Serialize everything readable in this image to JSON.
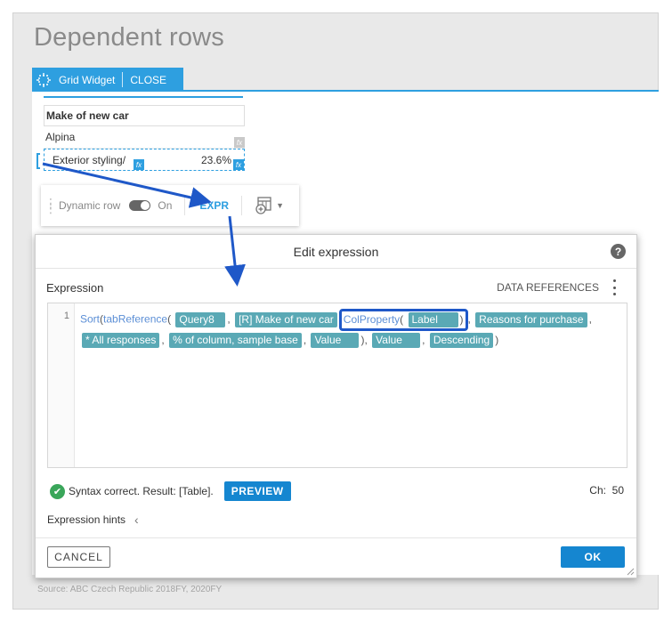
{
  "page": {
    "title": "Dependent rows",
    "source": "Source: ABC Czech Republic 2018FY, 2020FY"
  },
  "widget_toolbar": {
    "label": "Grid Widget",
    "close": "CLOSE"
  },
  "grid": {
    "header": "Make of new car",
    "rows": [
      {
        "label": "Alpina",
        "value": ""
      },
      {
        "label": "Exterior styling/",
        "value": "23.6%"
      }
    ],
    "fx_label": "fx"
  },
  "row_toolbar": {
    "dynamic_row_label": "Dynamic row",
    "toggle_state": "On",
    "expr_button": "EXPR"
  },
  "dialog": {
    "title": "Edit expression",
    "help": "?",
    "expression_label": "Expression",
    "data_references": "DATA REFERENCES",
    "line_number": "1",
    "code": {
      "sort_fn": "Sort",
      "tabref_fn": "tabReference",
      "query": "Query8",
      "make": "[R] Make of new car",
      "colprop_fn": "ColProperty",
      "label_tok": "Label",
      "reasons": "Reasons for purchase",
      "all_responses": "* All responses",
      "pct_column": "% of column, sample base",
      "value1": "Value",
      "value2": "Value",
      "descending": "Descending"
    },
    "status_text": "Syntax correct. Result: [Table].",
    "preview_button": "PREVIEW",
    "ch_label": "Ch:",
    "ch_value": "50",
    "hints_label": "Expression hints",
    "cancel_button": "CANCEL",
    "ok_button": "OK"
  },
  "colors": {
    "accent": "#2e9fe0",
    "primary_button": "#1586d0",
    "token": "#5aa9b5",
    "highlight_box": "#1f58c8",
    "success": "#3aa65a"
  }
}
